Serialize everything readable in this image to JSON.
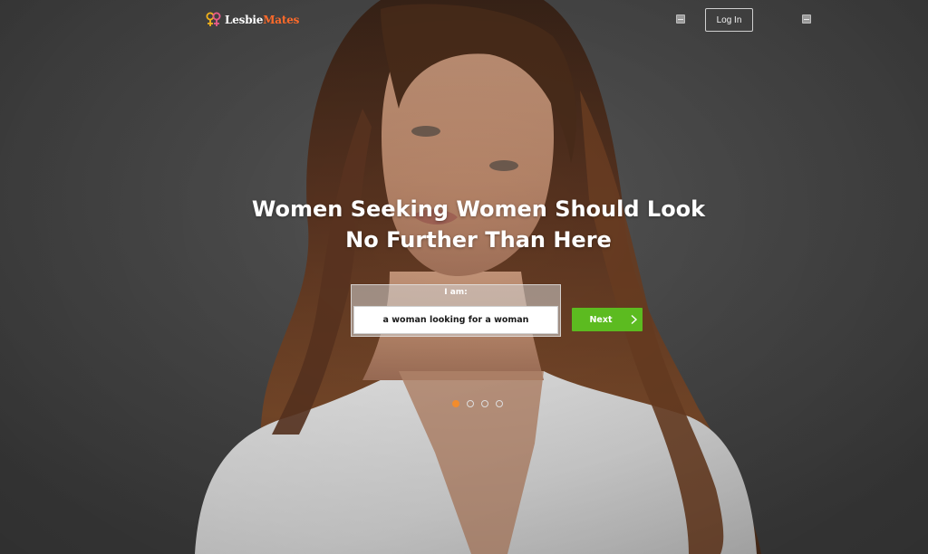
{
  "brand": {
    "name_part1": "Lesbie",
    "name_part2": "Mates",
    "icon": "double-venus-icon",
    "colors": {
      "accent_orange": "#ff6a2a",
      "venus_yellow": "#f2b21b",
      "venus_pink": "#e85b8a"
    }
  },
  "header": {
    "login_label": "Log In",
    "menu_icons": [
      "menu-icon",
      "menu-icon"
    ]
  },
  "hero": {
    "headline": "Women Seeking Women Should Look No Further Than Here",
    "form": {
      "label": "I am:",
      "selected_value": "a woman looking for a woman"
    },
    "next_button": {
      "label": "Next",
      "icon": "chevron-right-icon",
      "color": "#5cbb20"
    },
    "carousel": {
      "slide_count": 4,
      "active_index": 0,
      "active_color": "#f28c2c"
    }
  }
}
